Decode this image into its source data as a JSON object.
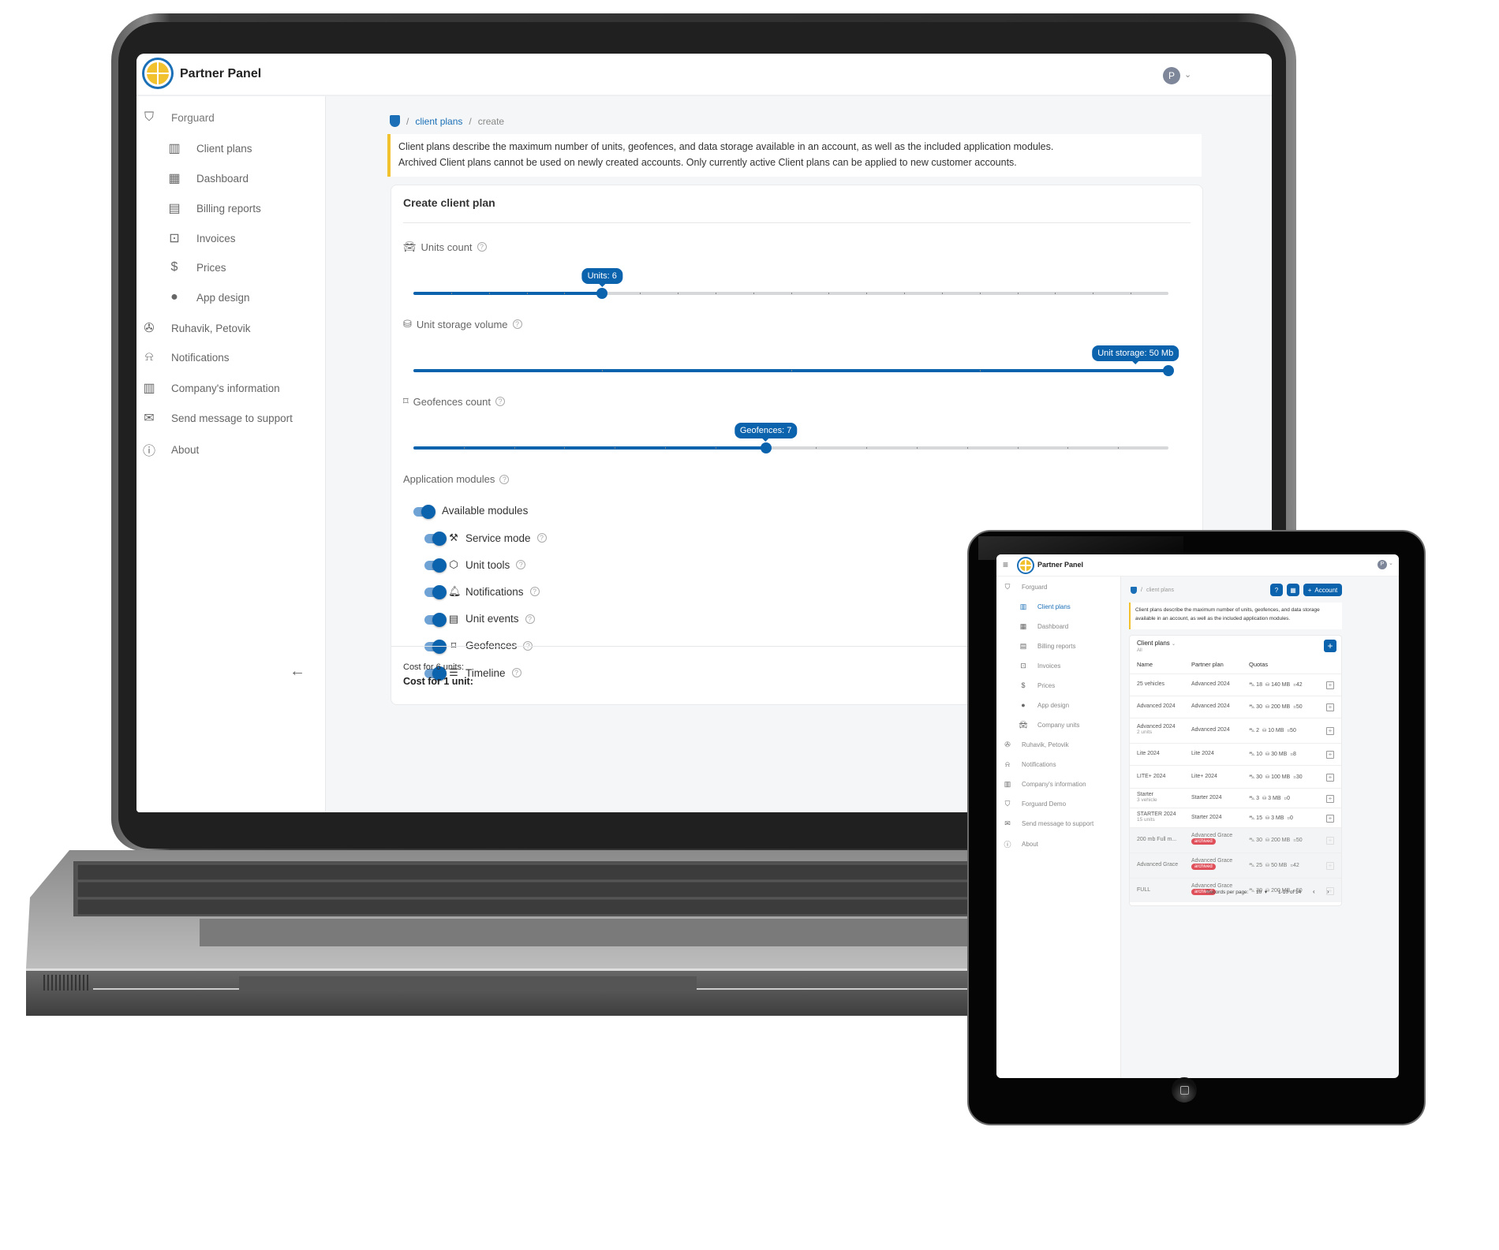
{
  "laptop": {
    "header": {
      "brand": "Partner Panel",
      "avatar_initial": "P"
    },
    "sidebar": {
      "items": [
        {
          "label": "Forguard",
          "icon": "shield-icon",
          "level": 0
        },
        {
          "label": "Client plans",
          "icon": "plans-icon",
          "level": 1
        },
        {
          "label": "Dashboard",
          "icon": "dashboard-icon",
          "level": 1
        },
        {
          "label": "Billing reports",
          "icon": "billing-icon",
          "level": 1
        },
        {
          "label": "Invoices",
          "icon": "invoice-icon",
          "level": 1
        },
        {
          "label": "Prices",
          "icon": "dollar-icon",
          "level": 1
        },
        {
          "label": "App design",
          "icon": "palette-icon",
          "level": 1
        },
        {
          "label": "Ruhavik, Petovik",
          "icon": "wheel-icon",
          "level": 0
        },
        {
          "label": "Notifications",
          "icon": "bell-icon",
          "level": 0
        },
        {
          "label": "Company's information",
          "icon": "building-icon",
          "level": 0
        },
        {
          "label": "Send message to support",
          "icon": "mail-icon",
          "level": 0
        },
        {
          "label": "About",
          "icon": "info-icon",
          "level": 0
        }
      ],
      "collapse_icon": "arrow-left-icon"
    },
    "breadcrumb": {
      "link": "client plans",
      "current": "create",
      "sep": "/"
    },
    "notice": {
      "line1": "Client plans describe the maximum number of units, geofences, and data storage available in an account, as well as the included application modules.",
      "line2": "Archived Client plans cannot be used on newly created accounts. Only currently active Client plans can be applied to new customer accounts."
    },
    "form": {
      "title": "Create client plan",
      "sliders": [
        {
          "label": "Units count",
          "icon": "car-icon",
          "tooltip": "Units: 6",
          "value": 6,
          "min": 1,
          "max": 21,
          "steps": 20
        },
        {
          "label": "Unit storage volume",
          "icon": "database-icon",
          "tooltip": "Unit storage: 50 Mb",
          "value": 50,
          "min": 10,
          "max": 50,
          "steps": 4
        },
        {
          "label": "Geofences count",
          "icon": "geofence-icon",
          "tooltip": "Geofences: 7",
          "value": 7,
          "min": 0,
          "max": 15,
          "steps": 15
        }
      ],
      "modules_label": "Application modules",
      "available_label": "Available modules",
      "available_on": true,
      "modules": [
        {
          "label": "Service mode",
          "icon": "wrench-icon",
          "glyph": "⚒",
          "on": true
        },
        {
          "label": "Unit tools",
          "icon": "cube-icon",
          "glyph": "⬡",
          "on": true
        },
        {
          "label": "Notifications",
          "icon": "bell-icon",
          "glyph": "🔔︎",
          "on": true
        },
        {
          "label": "Unit events",
          "icon": "calendar-icon",
          "glyph": "▤",
          "on": true
        },
        {
          "label": "Geofences",
          "icon": "geofence-icon",
          "glyph": "⌑",
          "on": true
        },
        {
          "label": "Timeline",
          "icon": "timeline-icon",
          "glyph": "☰",
          "on": true
        }
      ],
      "cost_units": "Cost for 6 units:",
      "cost_unit": "Cost for 1 unit:"
    }
  },
  "tablet": {
    "header": {
      "brand": "Partner Panel",
      "avatar_initial": "P"
    },
    "sidebar": {
      "items": [
        {
          "label": "Forguard",
          "icon": "shield-icon",
          "level": 0
        },
        {
          "label": "Client plans",
          "icon": "plans-icon",
          "level": 1,
          "active": true
        },
        {
          "label": "Dashboard",
          "icon": "dashboard-icon",
          "level": 1
        },
        {
          "label": "Billing reports",
          "icon": "billing-icon",
          "level": 1
        },
        {
          "label": "Invoices",
          "icon": "invoice-icon",
          "level": 1
        },
        {
          "label": "Prices",
          "icon": "dollar-icon",
          "level": 1
        },
        {
          "label": "App design",
          "icon": "palette-icon",
          "level": 1
        },
        {
          "label": "Company units",
          "icon": "car-icon",
          "level": 1
        },
        {
          "label": "Ruhavik, Petovik",
          "icon": "wheel-icon",
          "level": 0
        },
        {
          "label": "Notifications",
          "icon": "bell-icon",
          "level": 0
        },
        {
          "label": "Company's information",
          "icon": "building-icon",
          "level": 0
        },
        {
          "label": "Forguard Demo",
          "icon": "shield-icon",
          "level": 0
        },
        {
          "label": "Send message to support",
          "icon": "mail-icon",
          "level": 0
        },
        {
          "label": "About",
          "icon": "info-icon",
          "level": 0
        }
      ]
    },
    "breadcrumb": {
      "link": "client plans"
    },
    "toolbar": {
      "account_label": "Account"
    },
    "notice": {
      "text": "Client plans describe the maximum number of units, geofences, and data storage available in an account, as well as the included application modules."
    },
    "table": {
      "title": "Client plans",
      "filter": "All",
      "columns": [
        "Name",
        "Partner plan",
        "Quotas"
      ],
      "rows": [
        {
          "name": "25 vehicles",
          "sub": "",
          "plan": "Advanced 2024",
          "archived": false,
          "units": "18",
          "storage": "140 MB",
          "geofences": "42"
        },
        {
          "name": "Advanced 2024",
          "sub": "",
          "plan": "Advanced 2024",
          "archived": false,
          "units": "30",
          "storage": "200 MB",
          "geofences": "50"
        },
        {
          "name": "Advanced 2024",
          "sub": "2 units",
          "plan": "Advanced 2024",
          "archived": false,
          "units": "2",
          "storage": "10 MB",
          "geofences": "50"
        },
        {
          "name": "Lite 2024",
          "sub": "",
          "plan": "Lite 2024",
          "archived": false,
          "units": "10",
          "storage": "30 MB",
          "geofences": "8"
        },
        {
          "name": "LITE+ 2024",
          "sub": "",
          "plan": "Lite+ 2024",
          "archived": false,
          "units": "30",
          "storage": "100 MB",
          "geofences": "30"
        },
        {
          "name": "Starter",
          "sub": "3 vehicle",
          "plan": "Starter 2024",
          "archived": false,
          "units": "3",
          "storage": "3 MB",
          "geofences": "0"
        },
        {
          "name": "STARTER 2024",
          "sub": "15 units",
          "plan": "Starter 2024",
          "archived": false,
          "units": "15",
          "storage": "3 MB",
          "geofences": "0"
        },
        {
          "name": "200 mb Full m...",
          "sub": "",
          "plan": "Advanced Grace",
          "archived": true,
          "units": "30",
          "storage": "200 MB",
          "geofences": "50"
        },
        {
          "name": "Advanced Grace",
          "sub": "",
          "plan": "Advanced Grace",
          "archived": true,
          "units": "25",
          "storage": "50 MB",
          "geofences": "42"
        },
        {
          "name": "FULL",
          "sub": "",
          "plan": "Advanced Grace",
          "archived": true,
          "units": "30",
          "storage": "200 MB",
          "geofences": "50"
        }
      ],
      "archived_label": "archived",
      "pagination": {
        "records_label": "Records per page:",
        "per_page": "10",
        "range": "1-10 of 14"
      }
    }
  },
  "colors": {
    "accent": "#0b62ad",
    "warning_bar": "#f2c12e",
    "archived_badge": "#e0505b",
    "avatar": "#7d8799"
  }
}
